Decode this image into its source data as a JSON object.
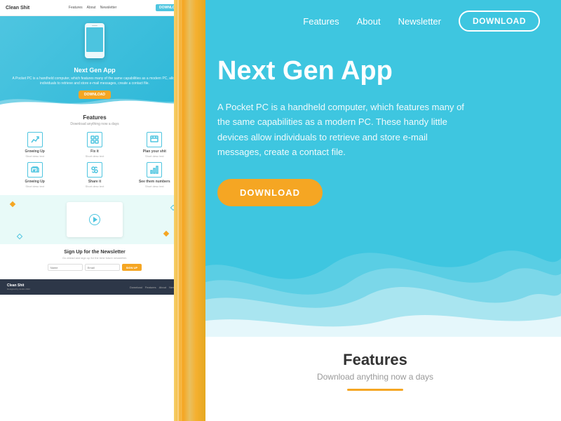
{
  "leftPanel": {
    "nav": {
      "brand": "Clean Shit",
      "links": [
        "Features",
        "About",
        "Newsletter"
      ],
      "downloadLabel": "DOWNLOAD"
    },
    "hero": {
      "title": "Next Gen App",
      "text": "A Pocket PC is a handheld computer, which features many of the same capabilities as a modern PC, allow individuals to retrieve and store e-mail messages, create a contact file.",
      "buttonLabel": "DOWNLOAD"
    },
    "features": {
      "title": "Features",
      "subtitle": "Download anything now a days",
      "items": [
        {
          "label": "Growing Up",
          "desc": "Short description here"
        },
        {
          "label": "Fix it",
          "desc": "Short description here"
        },
        {
          "label": "Plan your shit",
          "desc": "Short description here"
        },
        {
          "label": "Growing Up",
          "desc": "Short description here"
        },
        {
          "label": "Share it",
          "desc": "Short description here"
        },
        {
          "label": "See them number",
          "desc": "Short description here"
        }
      ]
    },
    "newsletter": {
      "title": "Sign Up for the Newsletter",
      "subtitle": "Go ahead and sign up for the best future newsletter.",
      "namePlaceholder": "Name",
      "emailPlaceholder": "Email",
      "buttonLabel": "SIGN UP"
    },
    "footer": {
      "brand": "Clean Shit",
      "copyright": "Designed by André 2022",
      "links": [
        "Download",
        "Features",
        "About",
        "Newsletter"
      ]
    }
  },
  "rightPanel": {
    "nav": {
      "links": [
        "Features",
        "About",
        "Newsletter"
      ],
      "downloadLabel": "DOWNLOAD"
    },
    "hero": {
      "title": "Next Gen App",
      "text": "A Pocket PC is a handheld computer, which features many of the same capabilities as a modern PC. These handy little devices allow individuals to retrieve and store e-mail messages, create a contact file.",
      "buttonLabel": "DOWNLOAD"
    },
    "features": {
      "title": "Features",
      "subtitle": "Download anything now a days"
    }
  },
  "colors": {
    "accent": "#4ec5e0",
    "orange": "#f5a623",
    "dark": "#2d3748",
    "white": "#ffffff"
  }
}
